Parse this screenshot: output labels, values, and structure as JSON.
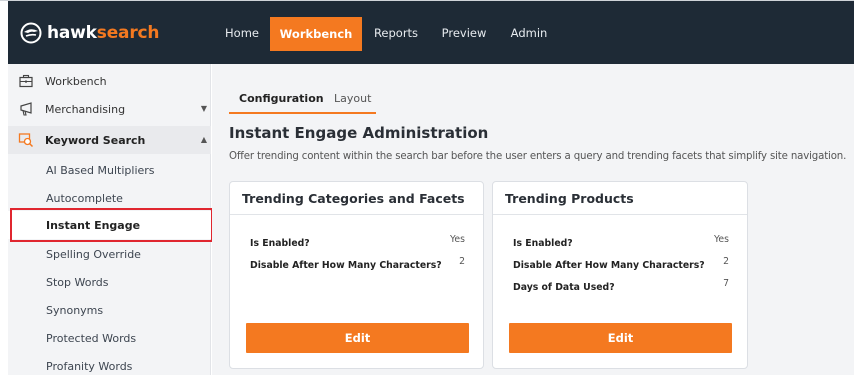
{
  "brand": {
    "part1": "hawk",
    "part2": "search"
  },
  "nav": {
    "items": [
      "Home",
      "Workbench",
      "Reports",
      "Preview",
      "Admin"
    ],
    "active": "Workbench"
  },
  "sidebar": {
    "items": [
      {
        "label": "Workbench",
        "icon": "briefcase-icon"
      },
      {
        "label": "Merchandising",
        "icon": "megaphone-icon"
      },
      {
        "label": "Keyword Search",
        "icon": "search-icon"
      }
    ],
    "subitems": [
      "AI Based Multipliers",
      "Autocomplete",
      "Instant Engage",
      "Spelling Override",
      "Stop Words",
      "Synonyms",
      "Protected Words",
      "Profanity Words"
    ],
    "active_subitem": "Instant Engage"
  },
  "tabs": [
    "Configuration",
    "Layout"
  ],
  "page": {
    "title": "Instant Engage Administration",
    "subtitle": "Offer trending content within the search bar before the user enters a query and trending facets that simplify site navigation."
  },
  "cards": [
    {
      "title": "Trending Categories and Facets",
      "rows": [
        {
          "label": "Is Enabled?",
          "value": "Yes"
        },
        {
          "label": "Disable After How Many Characters?",
          "value": "2"
        }
      ],
      "button": "Edit"
    },
    {
      "title": "Trending Products",
      "rows": [
        {
          "label": "Is Enabled?",
          "value": "Yes"
        },
        {
          "label": "Disable After How Many Characters?",
          "value": "2"
        },
        {
          "label": "Days of Data Used?",
          "value": "7"
        }
      ],
      "button": "Edit"
    }
  ],
  "colors": {
    "navbar": "#1e2a36",
    "accent": "#f47920",
    "highlight": "#e0262f",
    "content_bg": "#f3f4f6"
  }
}
